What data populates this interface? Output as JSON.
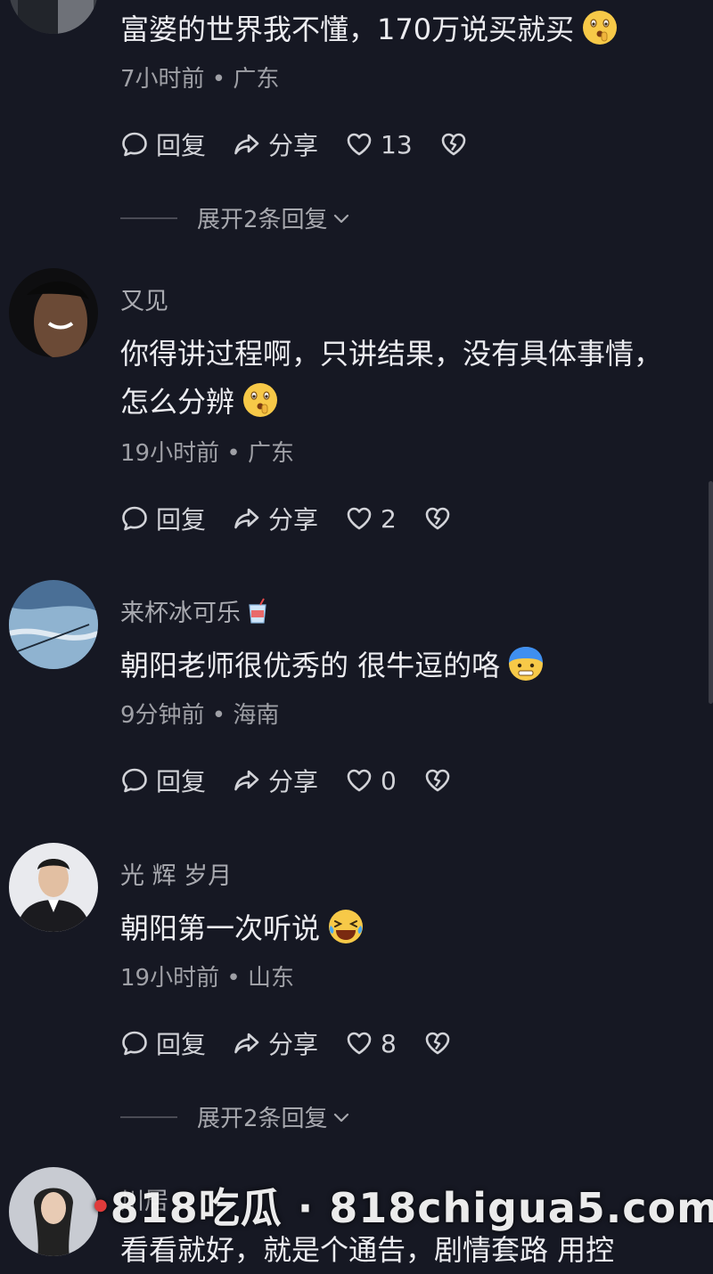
{
  "comments": [
    {
      "content": "富婆的世界我不懂，170万说买就买",
      "meta": "7小时前 • 广东",
      "reply_label": "回复",
      "share_label": "分享",
      "likes": "13",
      "expand_label": "展开2条回复"
    },
    {
      "username": "又见",
      "content": "你得讲过程啊，只讲结果，没有具体事情，怎么分辨",
      "meta": "19小时前 • 广东",
      "reply_label": "回复",
      "share_label": "分享",
      "likes": "2"
    },
    {
      "username": "来杯冰可乐",
      "content": "朝阳老师很优秀的 很牛逗的咯",
      "meta": "9分钟前 • 海南",
      "reply_label": "回复",
      "share_label": "分享",
      "likes": "0"
    },
    {
      "username": "光 辉 岁月",
      "content": "朝阳第一次听说",
      "meta": "19小时前 • 山东",
      "reply_label": "回复",
      "share_label": "分享",
      "likes": "8",
      "expand_label": "展开2条回复"
    },
    {
      "username": "川居",
      "content": "看看就好，就是个通告，剧情套路 用控"
    }
  ],
  "watermark": "818吃瓜 · 818chigua5.com",
  "icons": {
    "comment": "speech-bubble-icon",
    "share": "share-arrow-icon",
    "like": "heart-icon",
    "dislike": "broken-heart-icon",
    "expand": "chevron-down-icon"
  },
  "colors": {
    "background": "#161823",
    "text": "#ececf0",
    "muted": "#9fa0a6"
  }
}
